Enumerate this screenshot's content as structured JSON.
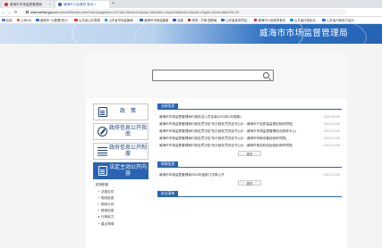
{
  "browser": {
    "tabs": [
      {
        "label": "威海市市场监督管理局",
        "close": "×"
      },
      {
        "label": "威海市人民政府 首页 ×",
        "close": "×"
      }
    ],
    "new_tab": "+",
    "nav": {
      "back": "←",
      "forward": "→",
      "reload": "⟳"
    },
    "url_domain": "www.weihai.gov.cn",
    "url_rest": "/col/col150/index.html?uid=&pageNum=1#?cid=15&sort=1&seq=1&sOrder=1&pid=85&tcid=10&cid=12&gId=1&uid=68&sTId=10"
  },
  "bookmarks": [
    {
      "label": "应用",
      "color": "#4a7fd4"
    },
    {
      "label": "公司OA",
      "color": "#e06a2b"
    },
    {
      "label": "威海市 \"大数据\"统计...",
      "color": "#2b72d4"
    },
    {
      "label": "山东省公共资源",
      "color": "#d43b2b"
    },
    {
      "label": "山东省市场监管局...",
      "color": "#2b8cd4"
    },
    {
      "label": "威海市市场监管局",
      "color": "#2b62b4"
    },
    {
      "label": "百度",
      "color": "#2b4fd4"
    },
    {
      "label": "财务 - 打单 国税局",
      "color": "#c42b2b"
    },
    {
      "label": "山东省投资项目...",
      "color": "#2b72d4"
    },
    {
      "label": "威海市人民政府首页",
      "color": "#d42b2b"
    },
    {
      "label": "山东省行政执法...",
      "color": "#2b8cd4"
    },
    {
      "label": "山东省行政权力运行...",
      "color": "#2b72d4"
    }
  ],
  "site": {
    "title": "威海市市场监督管理局"
  },
  "leftnav": {
    "items": [
      {
        "label": "政　策",
        "icon": "document-icon"
      },
      {
        "label": "政府信息公开指南",
        "icon": "compass-icon"
      },
      {
        "label": "政府信息公开制度",
        "icon": "list-icon"
      },
      {
        "label": "法定主动公开内容",
        "icon": "clipboard-icon"
      }
    ],
    "sub_head": "机构职能",
    "sub_items": [
      "法规文件",
      "规划信息",
      "规划计划",
      "财政信息",
      "行政权力",
      "重点领域"
    ]
  },
  "sections": [
    {
      "tag": "业绩信息",
      "rows": [
        {
          "title": "威海市市场监督管理局行政执法人员名单(2023年2月更新)",
          "date": "2023-02-06"
        },
        {
          "title": "威海市市场监督管理局行政处罚决定书(行政处罚决定书公示 - 威海市产品质量监督检验研究院)",
          "date": "2022-12-05"
        },
        {
          "title": "威海市市场监督管理局行政处罚决定书(行政处罚决定书公示 - 威海市市场监督管理综合服务中心)",
          "date": "2022-12-05"
        },
        {
          "title": "威海市市场监督管理局行政处罚决定书(行政处罚决定书公示 - 威海市特种设备检验研究院)",
          "date": "2022-12-05"
        },
        {
          "title": "威海市市场监督管理局行政处罚决定书(行政处罚决定书公示 - 威海市食品药品检验检测研究院)",
          "date": "2022-12-05"
        }
      ],
      "more": "更多"
    },
    {
      "tag": "财政信息",
      "rows": [
        {
          "title": "威海市市场监督管理局2022年度部门决算公开",
          "date": "2022-12-05"
        }
      ],
      "more": "更多"
    },
    {
      "tag": "执法清单",
      "rows": [],
      "more": ""
    }
  ]
}
